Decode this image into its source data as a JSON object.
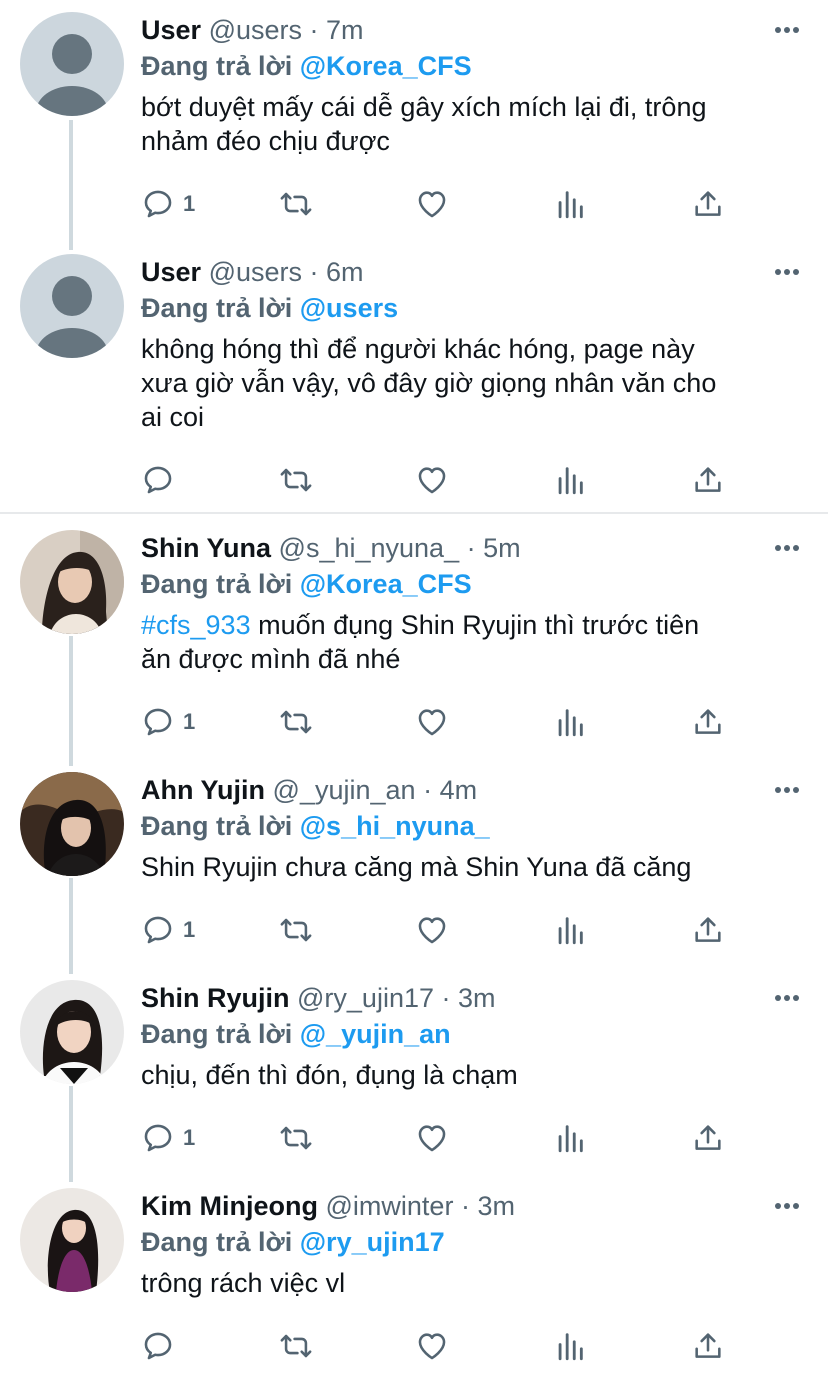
{
  "colors": {
    "accent": "#1d9bf0",
    "muted": "#536471",
    "text": "#0f1419"
  },
  "tweets": [
    {
      "name": "User",
      "handle": "@users",
      "dot": "·",
      "time": "7m",
      "reply_prefix": "Đang trả lời",
      "reply_to": "@Korea_CFS",
      "text_lines": [
        "bớt duyệt mấy cái dễ gây xích mích lại đi, trông",
        "nhảm đéo chịu được"
      ],
      "reply_count": "1",
      "avatar": "default-avatar"
    },
    {
      "name": "User",
      "handle": "@users",
      "dot": "·",
      "time": "6m",
      "reply_prefix": "Đang trả lời",
      "reply_to": "@users",
      "text_lines": [
        "không hóng thì để người khác hóng, page này",
        "xưa giờ vẫn vậy, vô đây giờ giọng nhân văn cho",
        "ai coi"
      ],
      "reply_count": "",
      "avatar": "default-avatar"
    },
    {
      "name": "Shin Yuna",
      "handle": "@s_hi_nyuna_",
      "dot": "·",
      "time": "5m",
      "reply_prefix": "Đang trả lời",
      "reply_to": "@Korea_CFS",
      "hashtag": "#cfs_933",
      "text_lines": [
        " muốn đụng Shin Ryujin thì trước tiên",
        "ăn được mình đã nhé"
      ],
      "reply_count": "1",
      "avatar": "photo-avatar"
    },
    {
      "name": "Ahn Yujin",
      "handle": "@_yujin_an",
      "dot": "·",
      "time": "4m",
      "reply_prefix": "Đang trả lời",
      "reply_to": "@s_hi_nyuna_",
      "text_lines": [
        "Shin Ryujin chưa căng mà Shin Yuna đã căng"
      ],
      "reply_count": "1",
      "avatar": "photo-avatar"
    },
    {
      "name": "Shin Ryujin",
      "handle": "@ry_ujin17",
      "dot": "·",
      "time": "3m",
      "reply_prefix": "Đang trả lời",
      "reply_to": "@_yujin_an",
      "text_lines": [
        "chịu, đến thì đón, đụng là chạm"
      ],
      "reply_count": "1",
      "avatar": "photo-avatar"
    },
    {
      "name": "Kim Minjeong",
      "handle": "@imwinter",
      "dot": "·",
      "time": "3m",
      "reply_prefix": "Đang trả lời",
      "reply_to": "@ry_ujin17",
      "text_lines": [
        "trông rách việc vl"
      ],
      "reply_count": "",
      "avatar": "photo-avatar"
    }
  ]
}
